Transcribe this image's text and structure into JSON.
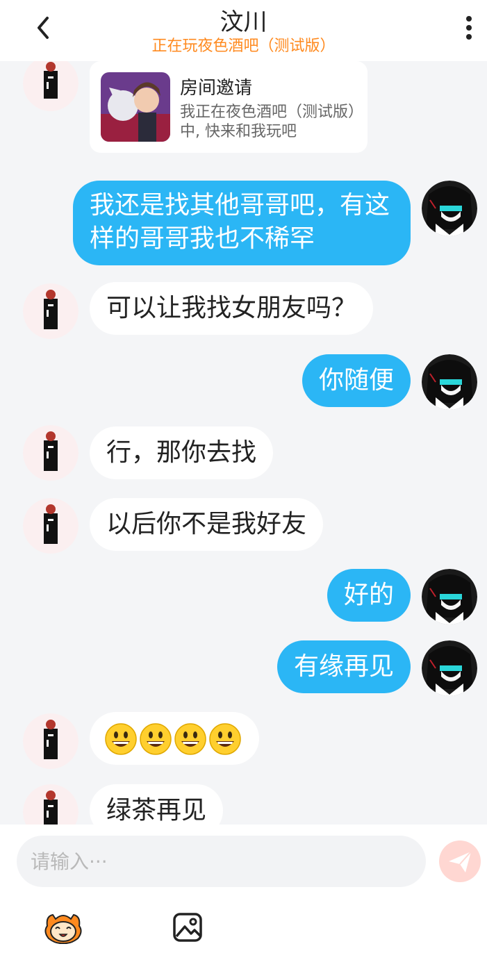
{
  "header": {
    "title": "汶川",
    "subtitle": "正在玩夜色酒吧（测试版）",
    "accent_color": "#ff8a1f"
  },
  "invite": {
    "title": "房间邀请",
    "desc": "我正在夜色酒吧（测试版）中, 快来和我玩吧"
  },
  "messages": [
    {
      "side": "right",
      "text": "我还是找其他哥哥吧，有这样的哥哥我也不稀罕"
    },
    {
      "side": "left",
      "text": "可以让我找女朋友吗？"
    },
    {
      "side": "right",
      "text": "你随便"
    },
    {
      "side": "left",
      "text": "行，那你去找"
    },
    {
      "side": "left",
      "text": "以后你不是我好友"
    },
    {
      "side": "right",
      "text": "好的"
    },
    {
      "side": "right",
      "text": "有缘再见"
    },
    {
      "side": "left",
      "text": "",
      "emoji": [
        "grinning-face-emoji",
        "grinning-face-emoji",
        "grinning-face-emoji",
        "grinning-face-emoji"
      ]
    },
    {
      "side": "left",
      "text": "绿茶再见"
    }
  ],
  "composer": {
    "placeholder": "请输入···",
    "send_icon": "send-icon",
    "sticker_icon": "sticker-icon",
    "image_icon": "image-icon"
  },
  "colors": {
    "my_bubble": "#2bb6f5",
    "their_bubble": "#ffffff",
    "background": "#f4f5f7"
  }
}
